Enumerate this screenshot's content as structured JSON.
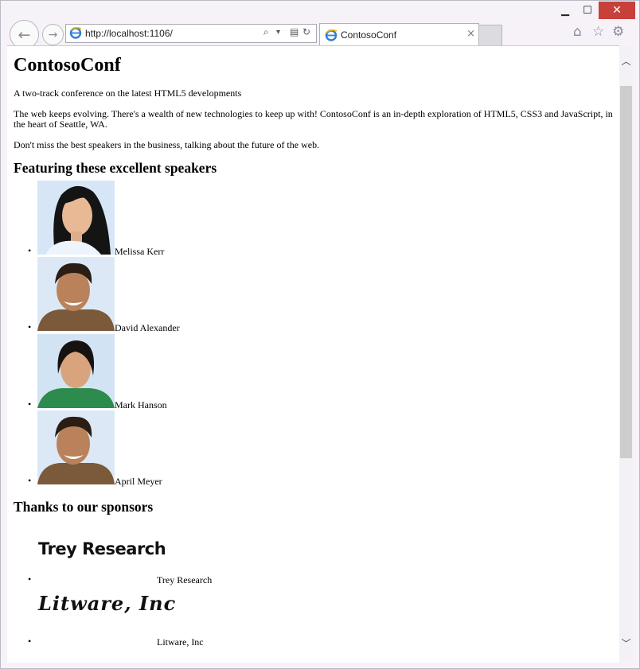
{
  "window": {
    "minimize_glyph": "▁",
    "maximize_glyph": "☐",
    "close_glyph": "✕"
  },
  "nav": {
    "back_glyph": "←",
    "forward_glyph": "→",
    "url": "http://localhost:1106/",
    "search_glyph": "⌕",
    "dropdown_glyph": "▾",
    "compat_glyph": "▤",
    "refresh_glyph": "↻"
  },
  "tab": {
    "title": "ContosoConf",
    "close_glyph": "×"
  },
  "toolbar": {
    "home_icon": "home-icon",
    "favorites_icon": "star-icon",
    "settings_icon": "gear-icon",
    "home_glyph": "⌂",
    "favorites_glyph": "☆",
    "settings_glyph": "⚙"
  },
  "page": {
    "title": "ContosoConf",
    "tagline": "A two-track conference on the latest HTML5 developments",
    "intro": "The web keeps evolving. There's a wealth of new technologies to keep up with! ContosoConf is an in-depth exploration of HTML5, CSS3 and JavaScript, in the heart of Seattle, WA.",
    "cta": "Don't miss the best speakers in the business, talking about the future of the web.",
    "speakers_heading": "Featuring these excellent speakers",
    "speakers": [
      {
        "name": "Melissa Kerr"
      },
      {
        "name": "David Alexander"
      },
      {
        "name": "Mark Hanson"
      },
      {
        "name": "April Meyer"
      }
    ],
    "sponsors_heading": "Thanks to our sponsors",
    "sponsors": [
      {
        "logo_text": "Trey Research",
        "name": "Trey Research"
      },
      {
        "logo_text": "Litware, Inc",
        "name": "Litware, Inc"
      }
    ]
  },
  "scrollbar": {
    "up_glyph": "︿",
    "down_glyph": "﹀"
  },
  "colors": {
    "close_button": "#c7403a",
    "window_frame": "#f6f2f8"
  }
}
